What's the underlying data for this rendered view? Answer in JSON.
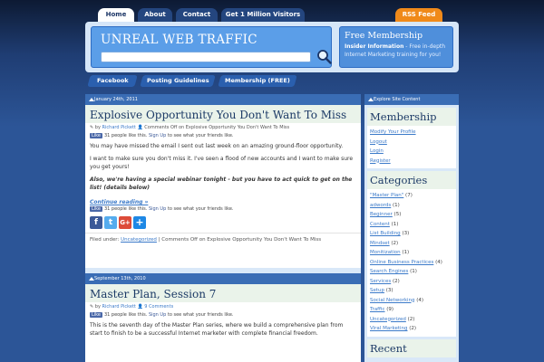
{
  "nav": {
    "tabs": [
      "Home",
      "About",
      "Contact",
      "Get 1 Million Visitors"
    ],
    "rss": "RSS Feed"
  },
  "header": {
    "logo": "UNREAL WEB TRAFFIC",
    "search": {
      "value": "",
      "placeholder": ""
    },
    "membership": {
      "title": "Free Membership",
      "strong": "Insider Information",
      "desc": " - Free in-depth Internet Marketing training for you!"
    }
  },
  "subnav": [
    "Facebook",
    "Posting Guidelines",
    "Membership (FREE)"
  ],
  "posts": [
    {
      "date": "January 24th, 2011",
      "title": "Explosive Opportunity You Don't Want To Miss",
      "by": "by",
      "author": "Richard Pickett",
      "comments": "Comments Off on Explosive Opportunity You Don't Want To Miss",
      "like_label": "Like",
      "like_count_text": "31 people like this.",
      "signup": "Sign Up",
      "signup_rest": "to see what your friends like.",
      "paragraphs": [
        "You may have missed the email I sent out last week on an amazing ground-floor opportunity.",
        "I want to make sure you don't miss it. I've seen a flood of new accounts and I want to make sure you get yours!",
        "Also, we're having a special webinar tonight - but you have to act quick to get on the list! (details below)"
      ],
      "continue": "Continue reading »",
      "filed_prefix": "Filed under:",
      "category": "Uncategorized",
      "filed_suffix": "| Comments Off on Explosive Opportunity You Don't Want To Miss"
    },
    {
      "date": "September 13th, 2010",
      "title": "Master Plan, Session 7",
      "by": "by",
      "author": "Richard Pickett",
      "comments": "9 Comments",
      "like_label": "Like",
      "like_count_text": "31 people like this.",
      "signup": "Sign Up",
      "signup_rest": "to see what your friends like.",
      "paragraphs": [
        "This is the seventh day of the Master Plan series, where we build a comprehensive plan from start to finish to be a successful Internet marketer with complete financial freedom."
      ]
    }
  ],
  "sidebar": {
    "header": "Explore Site Content",
    "membership": {
      "title": "Membership",
      "links": [
        "Modify Your Profile",
        "Logout",
        "Login",
        "Register"
      ]
    },
    "categories": {
      "title": "Categories",
      "items": [
        {
          "name": "\"Master Plan\"",
          "count": "(7)"
        },
        {
          "name": "adwords",
          "count": "(1)"
        },
        {
          "name": "Beginner",
          "count": "(5)"
        },
        {
          "name": "Content",
          "count": "(1)"
        },
        {
          "name": "List Building",
          "count": "(3)"
        },
        {
          "name": "Mindset",
          "count": "(2)"
        },
        {
          "name": "Monitization",
          "count": "(1)"
        },
        {
          "name": "Online Business Practices",
          "count": "(4)"
        },
        {
          "name": "Search Engines",
          "count": "(1)"
        },
        {
          "name": "Services",
          "count": "(2)"
        },
        {
          "name": "Setup",
          "count": "(3)"
        },
        {
          "name": "Social Networking",
          "count": "(4)"
        },
        {
          "name": "Traffic",
          "count": "(9)"
        },
        {
          "name": "Uncategorized",
          "count": "(2)"
        },
        {
          "name": "Viral Marketing",
          "count": "(2)"
        }
      ]
    },
    "recent": {
      "title": "Recent"
    }
  },
  "colors": {
    "page_bg": "#1b3566",
    "accent": "#3a6db5",
    "rss": "#f08a1a",
    "facebook": "#3b5998",
    "twitter": "#55acee",
    "google": "#dd4b39",
    "share": "#1e88e5"
  },
  "icons": {
    "search": "magnifier",
    "author": "pencil",
    "comments": "user",
    "share": [
      "facebook",
      "twitter",
      "google-plus",
      "share-plus"
    ]
  }
}
